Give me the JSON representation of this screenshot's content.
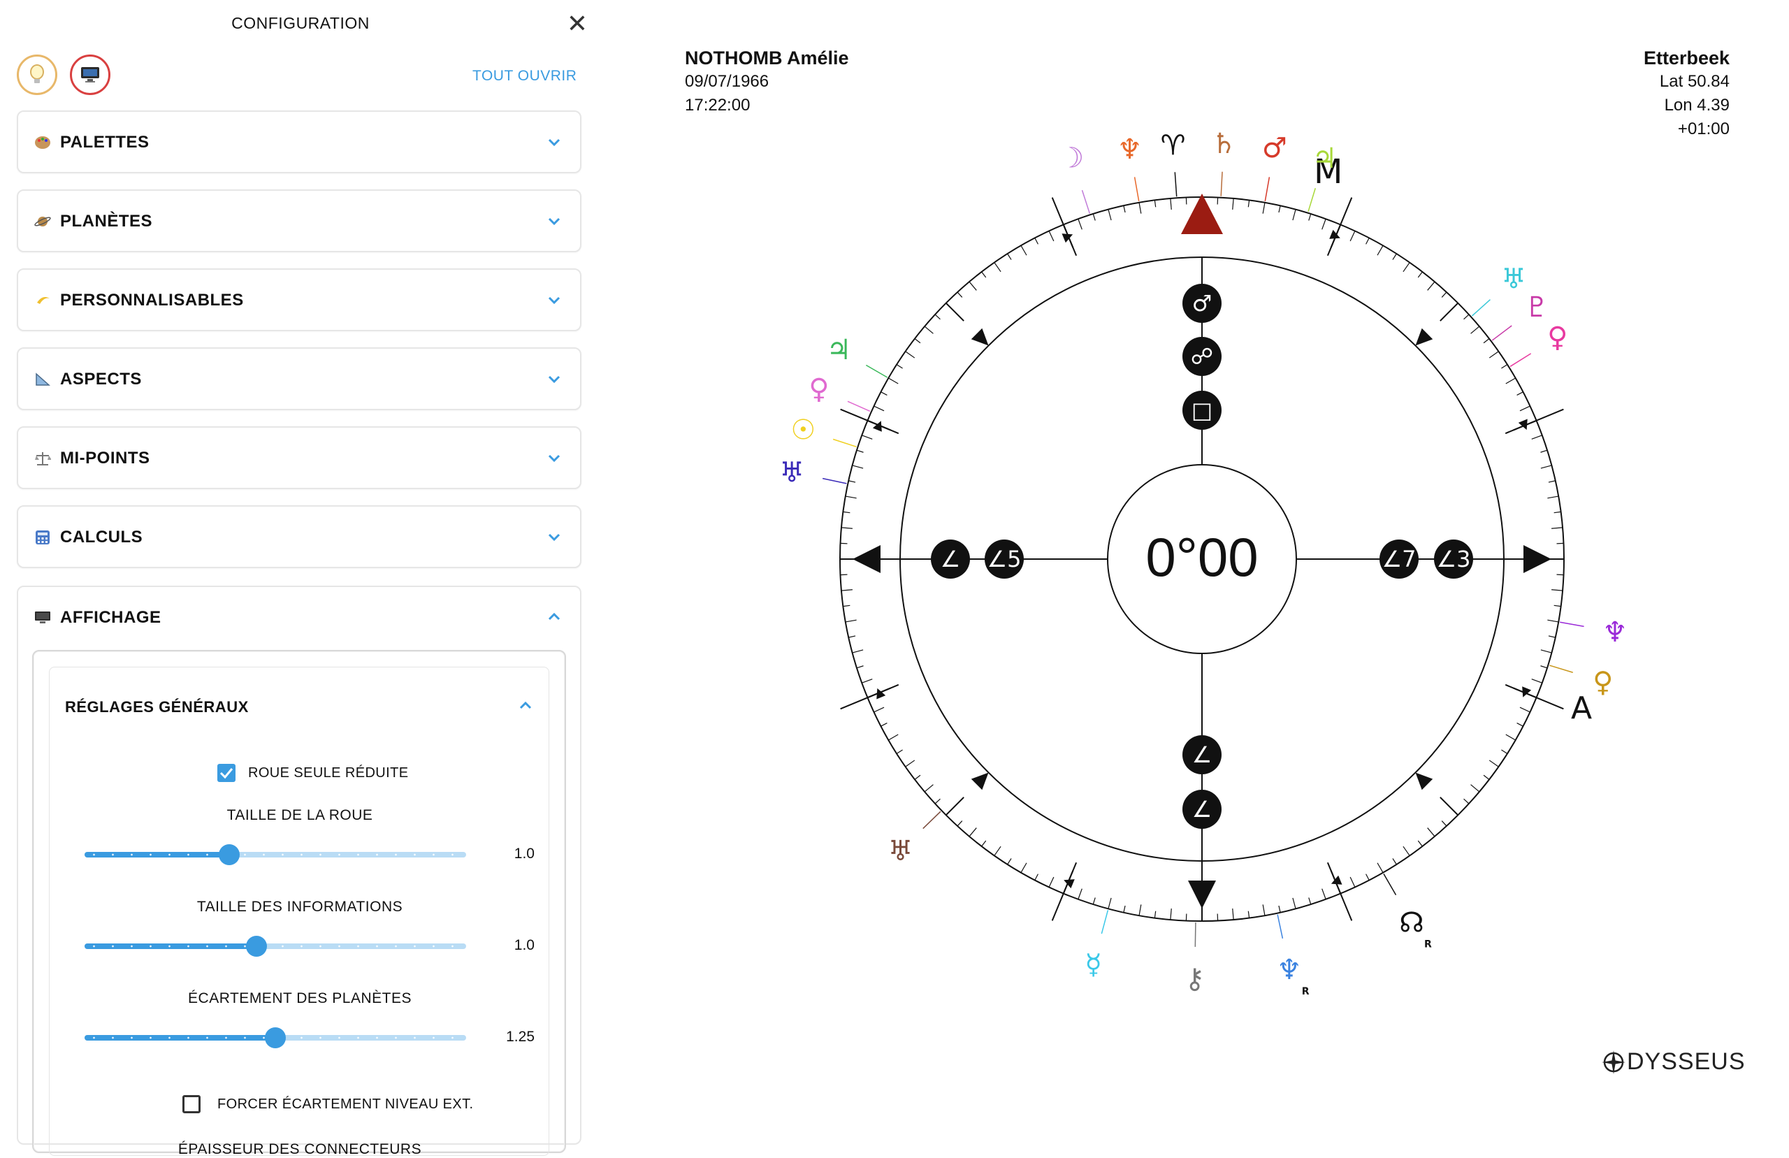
{
  "config": {
    "title": "CONFIGURATION",
    "open_all": "TOUT OUVRIR",
    "mode_buttons": [
      "lightbulb-icon",
      "screen-icon"
    ],
    "sections": [
      {
        "label": "PALETTES",
        "icon": "palette-icon"
      },
      {
        "label": "PLANÈTES",
        "icon": "planet-icon"
      },
      {
        "label": "PERSONNALISABLES",
        "icon": "crescent-icon"
      },
      {
        "label": "ASPECTS",
        "icon": "triangle-ruler-icon"
      },
      {
        "label": "MI-POINTS",
        "icon": "balance-icon"
      },
      {
        "label": "CALCULS",
        "icon": "calculator-icon"
      }
    ],
    "display": {
      "label": "AFFICHAGE",
      "icon": "screen-icon",
      "general": {
        "title": "RÉGLAGES GÉNÉRAUX",
        "reduced_wheel": {
          "label": "ROUE SEULE RÉDUITE",
          "checked": true
        },
        "sliders": [
          {
            "label": "TAILLE DE LA ROUE",
            "value": "1.0",
            "fraction": 0.38
          },
          {
            "label": "TAILLE DES INFORMATIONS",
            "value": "1.0",
            "fraction": 0.45
          },
          {
            "label": "ÉCARTEMENT DES PLANÈTES",
            "value": "1.25",
            "fraction": 0.5
          }
        ],
        "force_outer": {
          "label": "FORCER ÉCARTEMENT NIVEAU EXT.",
          "checked": false
        },
        "connector_label": "ÉPAISSEUR DES CONNECTEURS"
      }
    }
  },
  "chart_info": {
    "name": "NOTHOMB Amélie",
    "date": "09/07/1966",
    "time": "17:22:00",
    "place": "Etterbeek",
    "lat": "Lat 50.84",
    "lon": "Lon 4.39",
    "tz": "+01:00"
  },
  "wheel": {
    "center_text": "0°00",
    "mc_label": "M",
    "asc_label": "A",
    "north_marks": [
      "♂",
      "☍",
      "□"
    ],
    "south_marks": [
      "∠",
      "∠"
    ],
    "west_marks": [
      "∠",
      "∠5"
    ],
    "east_marks": [
      "∠7",
      "∠3"
    ],
    "planets": [
      {
        "glyph": "☽",
        "name": "moon",
        "color": "#c07ad8"
      },
      {
        "glyph": "♆",
        "name": "poseidon",
        "color": "#e8682a"
      },
      {
        "glyph": "♈",
        "name": "aries-point",
        "color": "#111111"
      },
      {
        "glyph": "♄",
        "name": "saturn",
        "color": "#b86e3c"
      },
      {
        "glyph": "♂",
        "name": "mars",
        "color": "#d63a2a"
      },
      {
        "glyph": "♃",
        "name": "zeus",
        "color": "#a8d83a"
      },
      {
        "glyph": "♅",
        "name": "uranus",
        "color": "#3ac8d8"
      },
      {
        "glyph": "♇",
        "name": "pluto",
        "color": "#c83aa8"
      },
      {
        "glyph": "♀",
        "name": "venus",
        "color": "#e83aa0"
      },
      {
        "glyph": "♃",
        "name": "jupiter",
        "color": "#3ab85a"
      },
      {
        "glyph": "♀",
        "name": "kronos",
        "color": "#e06ad0"
      },
      {
        "glyph": "☉",
        "name": "sun",
        "color": "#f0d020"
      },
      {
        "glyph": "♅",
        "name": "hades",
        "color": "#3a2ab8"
      },
      {
        "glyph": "♆",
        "name": "vulkanus",
        "color": "#9a2ad8"
      },
      {
        "glyph": "♀",
        "name": "admetos",
        "color": "#c8961a"
      },
      {
        "glyph": "☊",
        "name": "node",
        "color": "#111111",
        "retro": "R"
      },
      {
        "glyph": "♆",
        "name": "neptune",
        "color": "#3a82e0",
        "retro": "R"
      },
      {
        "glyph": "⚷",
        "name": "chiron",
        "color": "#777777"
      },
      {
        "glyph": "☿",
        "name": "mercury",
        "color": "#3ac8e8"
      },
      {
        "glyph": "♅",
        "name": "apollon",
        "color": "#7a4a3a"
      }
    ]
  },
  "brand": "DYSSEUS"
}
